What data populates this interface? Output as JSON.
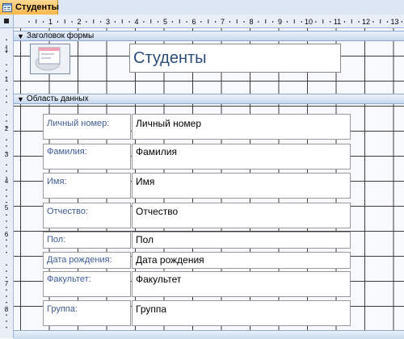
{
  "window": {
    "tab_title": "Студенты",
    "tab_icon": "form-icon",
    "accent_color": "#f9b84c"
  },
  "ruler": {
    "h_numbers": [
      "1",
      "2",
      "3",
      "4",
      "5",
      "6",
      "7",
      "8",
      "9",
      "10",
      "11",
      "12",
      "13"
    ],
    "v_numbers": [
      "1",
      "1",
      "2",
      "3",
      "4",
      "5",
      "6",
      "7",
      "8"
    ]
  },
  "sections": {
    "header": {
      "label": "Заголовок формы"
    },
    "detail": {
      "label": "Область данных"
    }
  },
  "form": {
    "title": "Студенты",
    "fields": [
      {
        "label": "Личный номер:",
        "value": "Личный номер"
      },
      {
        "label": "Фамилия:",
        "value": "Фамилия"
      },
      {
        "label": "Имя:",
        "value": "Имя"
      },
      {
        "label": "Отчество:",
        "value": "Отчество"
      },
      {
        "label": "Пол:",
        "value": "Пол"
      },
      {
        "label": "Дата рождения:",
        "value": "Дата рождения"
      },
      {
        "label": "Факультет:",
        "value": "Факультет"
      },
      {
        "label": "Группа:",
        "value": "Группа"
      }
    ]
  }
}
